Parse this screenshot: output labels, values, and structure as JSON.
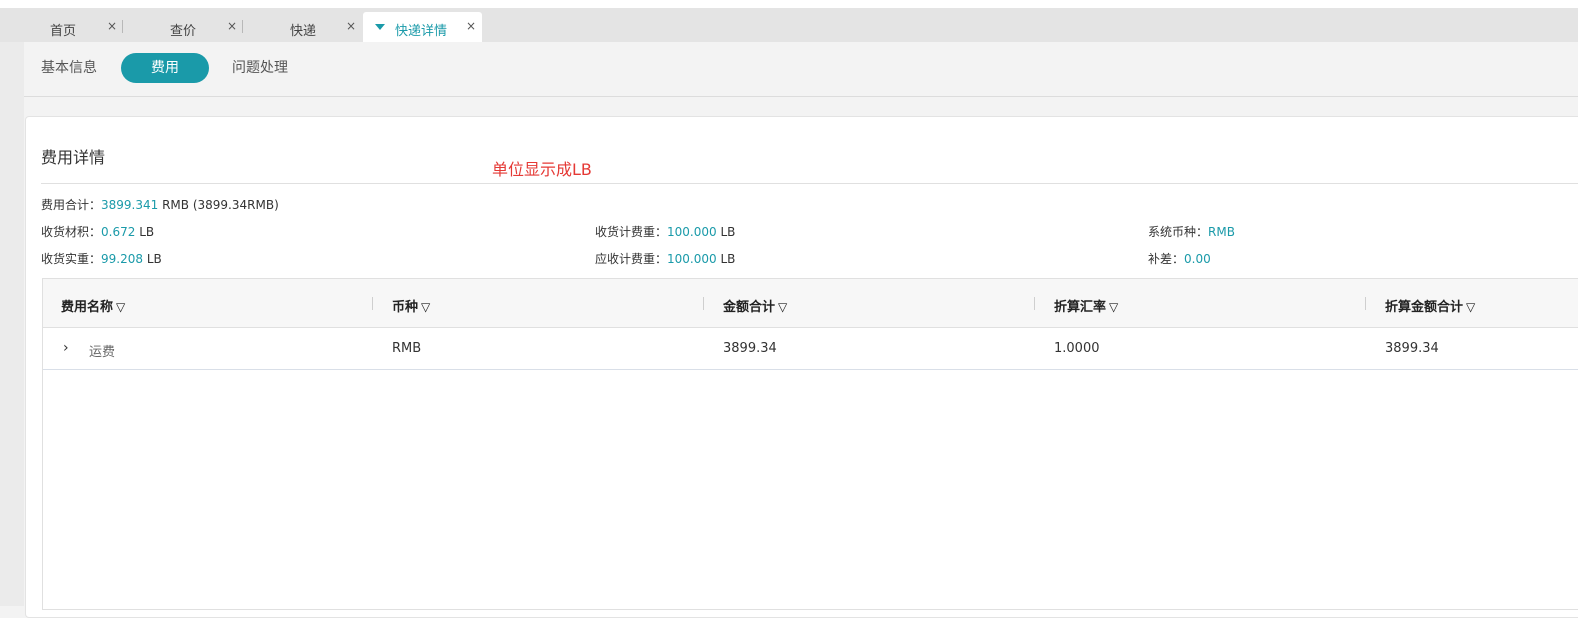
{
  "tabs": [
    {
      "label": "首页",
      "close": "×",
      "active": false
    },
    {
      "label": "查价",
      "close": "×",
      "active": false
    },
    {
      "label": "快递",
      "close": "×",
      "active": false
    },
    {
      "label": "快递详情",
      "close": "×",
      "active": true
    }
  ],
  "subtabs": [
    {
      "label": "基本信息",
      "active": false
    },
    {
      "label": "费用",
      "active": true
    },
    {
      "label": "问题处理",
      "active": false
    }
  ],
  "section": {
    "title": "费用详情",
    "annotation": "单位显示成LB"
  },
  "summary": {
    "total_label": "费用合计：",
    "total_value": "3899.341",
    "total_unit": " RMB  (3899.34RMB)",
    "items": [
      {
        "label": "收货材积：",
        "value": "0.672",
        "unit": " LB"
      },
      {
        "label": "收货计费重：",
        "value": "100.000",
        "unit": " LB"
      },
      {
        "label": "系统币种：",
        "value": "RMB",
        "unit": ""
      },
      {
        "label": "收货实重：",
        "value": "99.208",
        "unit": " LB"
      },
      {
        "label": "应收计费重：",
        "value": "100.000",
        "unit": " LB"
      },
      {
        "label": "补差：",
        "value": "0.00",
        "unit": ""
      }
    ]
  },
  "table": {
    "filter_icon": "▽",
    "columns": [
      "费用名称",
      "币种",
      "金额合计",
      "折算汇率",
      "折算金额合计"
    ],
    "rows": [
      {
        "expander": "›",
        "name": "运费",
        "currency": "RMB",
        "amount": "3899.34",
        "rate": "1.0000",
        "converted": "3899.34"
      }
    ]
  },
  "colors": {
    "accent": "#1a9aa9",
    "annotation": "#e53935"
  }
}
